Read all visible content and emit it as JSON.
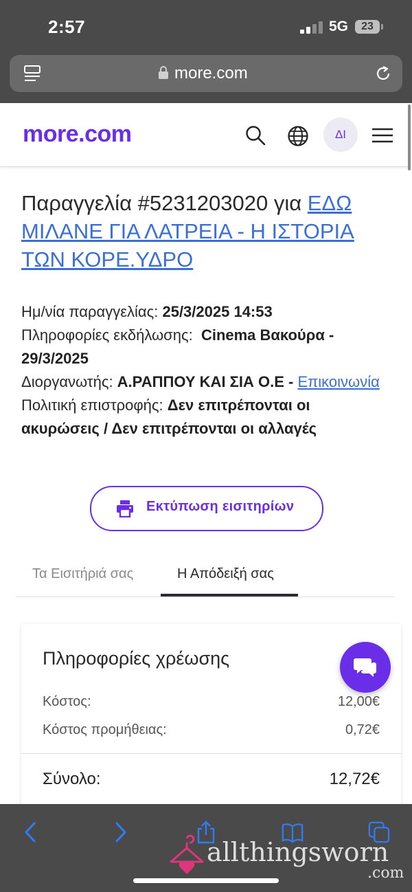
{
  "status": {
    "time": "2:57",
    "network": "5G",
    "battery": "23"
  },
  "browser": {
    "url": "more.com"
  },
  "site": {
    "logo": "more.com",
    "avatar_initials": "ΔΙ"
  },
  "order": {
    "title_prefix": "Παραγγελία #5231203020 για ",
    "event_link": "ΕΔΩ ΜΙΛΑΝΕ ΓΙΑ ΛΑΤΡΕΙΑ - Η ΙΣΤΟΡΙΑ ΤΩΝ ΚΟΡΕ.ΥΔΡΟ",
    "date_label": "Ημ/νία παραγγελίας: ",
    "date_value": "25/3/2025 14:53",
    "event_info_label": "Πληροφορίες εκδήλωσης: ",
    "event_info_value": "Cinema Βακούρα - 29/3/2025",
    "organizer_label": "Διοργανωτής: ",
    "organizer_value": "Α.ΡΑΠΠΟΥ ΚΑΙ ΣΙΑ Ο.Ε - ",
    "contact_link": "Επικοινωνία",
    "refund_label": "Πολιτική επιστροφής: ",
    "refund_value": "Δεν επιτρέπονται οι ακυρώσεις / Δεν επιτρέπονται οι αλλαγές"
  },
  "print_button": {
    "label": "Εκτύπωση εισιτηρίων"
  },
  "tabs": [
    {
      "label": "Τα Εισιτήριά σας",
      "active": false
    },
    {
      "label": "Η Απόδειξή σας",
      "active": true
    }
  ],
  "billing": {
    "title": "Πληροφορίες χρέωσης",
    "rows": [
      {
        "label": "Κόστος:",
        "value": "12,00€"
      },
      {
        "label": "Κόστος προμήθειας:",
        "value": "0,72€"
      }
    ],
    "total_label": "Σύνολο:",
    "total_value": "12,72€"
  },
  "watermark": {
    "text": "allthingsworn",
    "suffix": ".com"
  },
  "colors": {
    "brand": "#6b2ee8",
    "link": "#3a6fd8",
    "chrome": "#4a4a4a",
    "toolbar_icon": "#2f7cf6"
  }
}
